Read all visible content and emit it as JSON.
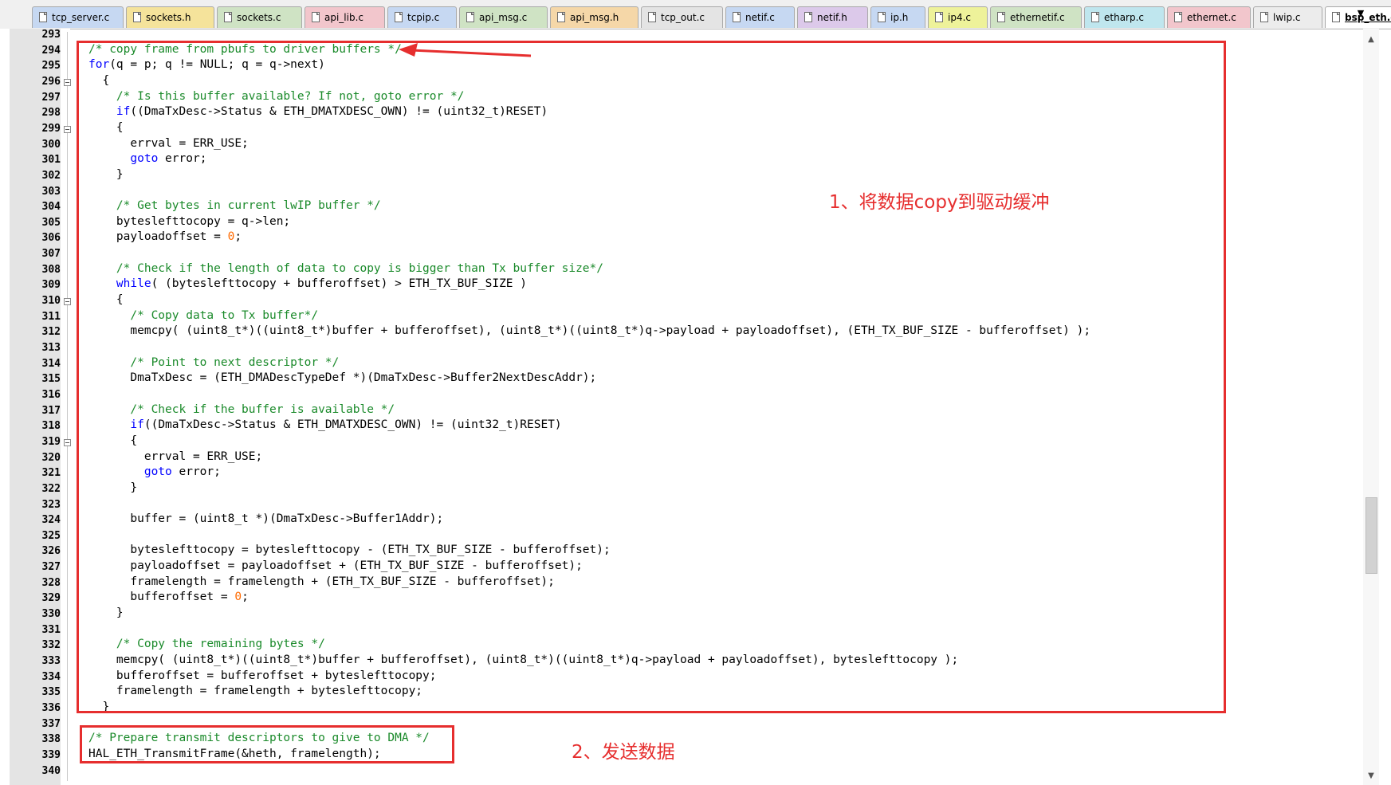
{
  "tabs": [
    {
      "label": "tcp_server.c",
      "color": "#c6d8f2"
    },
    {
      "label": "sockets.h",
      "color": "#f5e39b"
    },
    {
      "label": "sockets.c",
      "color": "#cfe3c4"
    },
    {
      "label": "api_lib.c",
      "color": "#f2c6cc"
    },
    {
      "label": "tcpip.c",
      "color": "#c6d8f2"
    },
    {
      "label": "api_msg.c",
      "color": "#cfe3c4"
    },
    {
      "label": "api_msg.h",
      "color": "#f5d7a8"
    },
    {
      "label": "tcp_out.c",
      "color": "#e4e4e4"
    },
    {
      "label": "netif.c",
      "color": "#c6d8f2"
    },
    {
      "label": "netif.h",
      "color": "#dcc9ea"
    },
    {
      "label": "ip.h",
      "color": "#c6d8f2"
    },
    {
      "label": "ip4.c",
      "color": "#eef29a"
    },
    {
      "label": "ethernetif.c",
      "color": "#cfe3c4"
    },
    {
      "label": "etharp.c",
      "color": "#bfe6ee"
    },
    {
      "label": "ethernet.c",
      "color": "#f2c6cc"
    },
    {
      "label": "lwip.c",
      "color": "#ececec"
    },
    {
      "label": "bsp_eth.c",
      "color": "#ffffff",
      "active": true
    }
  ],
  "tab_menu_arrow": "▼",
  "line_numbers": [
    "293",
    "294",
    "295",
    "296",
    "297",
    "298",
    "299",
    "300",
    "301",
    "302",
    "303",
    "304",
    "305",
    "306",
    "307",
    "308",
    "309",
    "310",
    "311",
    "312",
    "313",
    "314",
    "315",
    "316",
    "317",
    "318",
    "319",
    "320",
    "321",
    "322",
    "323",
    "324",
    "325",
    "326",
    "327",
    "328",
    "329",
    "330",
    "331",
    "332",
    "333",
    "334",
    "335",
    "336",
    "337",
    "338",
    "339",
    "340"
  ],
  "code_lines": [
    [],
    [
      [
        "c",
        "/* copy frame from pbufs to driver buffers */"
      ]
    ],
    [
      [
        "k",
        "for"
      ],
      [
        "t",
        "(q = p; q != NULL; q = q->next)"
      ]
    ],
    [
      [
        "t",
        "  {"
      ]
    ],
    [
      [
        "c",
        "    /* Is this buffer available? If not, goto error */"
      ]
    ],
    [
      [
        "t",
        "    "
      ],
      [
        "k",
        "if"
      ],
      [
        "t",
        "((DmaTxDesc->Status & ETH_DMATXDESC_OWN) != (uint32_t)RESET)"
      ]
    ],
    [
      [
        "t",
        "    {"
      ]
    ],
    [
      [
        "t",
        "      errval = ERR_USE;"
      ]
    ],
    [
      [
        "t",
        "      "
      ],
      [
        "k",
        "goto"
      ],
      [
        "t",
        " error;"
      ]
    ],
    [
      [
        "t",
        "    }"
      ]
    ],
    [],
    [
      [
        "c",
        "    /* Get bytes in current lwIP buffer */"
      ]
    ],
    [
      [
        "t",
        "    byteslefttocopy = q->len;"
      ]
    ],
    [
      [
        "t",
        "    payloadoffset = "
      ],
      [
        "n",
        "0"
      ],
      [
        "t",
        ";"
      ]
    ],
    [],
    [
      [
        "c",
        "    /* Check if the length of data to copy is bigger than Tx buffer size*/"
      ]
    ],
    [
      [
        "t",
        "    "
      ],
      [
        "k",
        "while"
      ],
      [
        "t",
        "( (byteslefttocopy + bufferoffset) > ETH_TX_BUF_SIZE )"
      ]
    ],
    [
      [
        "t",
        "    {"
      ]
    ],
    [
      [
        "c",
        "      /* Copy data to Tx buffer*/"
      ]
    ],
    [
      [
        "t",
        "      memcpy( (uint8_t*)((uint8_t*)buffer + bufferoffset), (uint8_t*)((uint8_t*)q->payload + payloadoffset), (ETH_TX_BUF_SIZE - bufferoffset) );"
      ]
    ],
    [],
    [
      [
        "c",
        "      /* Point to next descriptor */"
      ]
    ],
    [
      [
        "t",
        "      DmaTxDesc = (ETH_DMADescTypeDef *)(DmaTxDesc->Buffer2NextDescAddr);"
      ]
    ],
    [],
    [
      [
        "c",
        "      /* Check if the buffer is available */"
      ]
    ],
    [
      [
        "t",
        "      "
      ],
      [
        "k",
        "if"
      ],
      [
        "t",
        "((DmaTxDesc->Status & ETH_DMATXDESC_OWN) != (uint32_t)RESET)"
      ]
    ],
    [
      [
        "t",
        "      {"
      ]
    ],
    [
      [
        "t",
        "        errval = ERR_USE;"
      ]
    ],
    [
      [
        "t",
        "        "
      ],
      [
        "k",
        "goto"
      ],
      [
        "t",
        " error;"
      ]
    ],
    [
      [
        "t",
        "      }"
      ]
    ],
    [],
    [
      [
        "t",
        "      buffer = (uint8_t *)(DmaTxDesc->Buffer1Addr);"
      ]
    ],
    [],
    [
      [
        "t",
        "      byteslefttocopy = byteslefttocopy - (ETH_TX_BUF_SIZE - bufferoffset);"
      ]
    ],
    [
      [
        "t",
        "      payloadoffset = payloadoffset + (ETH_TX_BUF_SIZE - bufferoffset);"
      ]
    ],
    [
      [
        "t",
        "      framelength = framelength + (ETH_TX_BUF_SIZE - bufferoffset);"
      ]
    ],
    [
      [
        "t",
        "      bufferoffset = "
      ],
      [
        "n",
        "0"
      ],
      [
        "t",
        ";"
      ]
    ],
    [
      [
        "t",
        "    }"
      ]
    ],
    [],
    [
      [
        "c",
        "    /* Copy the remaining bytes */"
      ]
    ],
    [
      [
        "t",
        "    memcpy( (uint8_t*)((uint8_t*)buffer + bufferoffset), (uint8_t*)((uint8_t*)q->payload + payloadoffset), byteslefttocopy );"
      ]
    ],
    [
      [
        "t",
        "    bufferoffset = bufferoffset + byteslefttocopy;"
      ]
    ],
    [
      [
        "t",
        "    framelength = framelength + byteslefttocopy;"
      ]
    ],
    [
      [
        "t",
        "  }"
      ]
    ],
    [],
    [
      [
        "c",
        "/* Prepare transmit descriptors to give to DMA */"
      ]
    ],
    [
      [
        "t",
        "HAL_ETH_TransmitFrame(&heth, framelength);"
      ]
    ],
    []
  ],
  "fold_marker_lines": [
    "296",
    "299",
    "310",
    "319"
  ],
  "annotations": {
    "step1": "1、将数据copy到驱动缓冲",
    "step2": "2、发送数据"
  },
  "colors": {
    "comment": "#1a8a2a",
    "keyword": "#0000ff",
    "number": "#ff6a00",
    "annotation": "#e62e2e",
    "gutter": "#e4e4e4"
  }
}
